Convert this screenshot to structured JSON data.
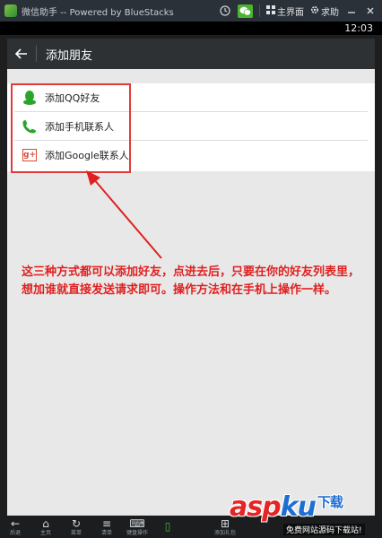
{
  "window": {
    "title": "微信助手 -- Powered by BlueStacks",
    "buttons": {
      "home": "主界面",
      "help": "求助"
    }
  },
  "statusbar": {
    "time": "12:03"
  },
  "actionbar": {
    "title": "添加朋友"
  },
  "list": {
    "items": [
      {
        "label": "添加QQ好友",
        "icon": "qq-penguin-icon"
      },
      {
        "label": "添加手机联系人",
        "icon": "phone-icon"
      },
      {
        "label": "添加Google联系人",
        "icon": "google-plus-icon"
      }
    ]
  },
  "annotation": {
    "text": "这三种方式都可以添加好友，点进去后，只要在你的好友列表里，想加谁就直接发送请求即可。操作方法和在手机上操作一样。"
  },
  "bottombar": {
    "items": [
      {
        "label": "后退",
        "icon": "back-arrow-icon"
      },
      {
        "label": "主页",
        "icon": "home-icon"
      },
      {
        "label": "菜单",
        "icon": "rotate-icon"
      },
      {
        "label": "清单",
        "icon": "menu-icon"
      },
      {
        "label": "键盘操作",
        "icon": "keyboard-icon"
      },
      {
        "label": "",
        "icon": "phone-device-icon"
      },
      {
        "label": "添加礼包",
        "icon": "gift-icon"
      },
      {
        "label": "",
        "icon": "blank"
      }
    ]
  },
  "watermark": {
    "logo_asp": "asp",
    "logo_ku": "ku",
    "logo_cn": "下载",
    "sub": "免费网站源码下载站!"
  },
  "colors": {
    "accent_green": "#4bb52f",
    "annotation_red": "#e02020",
    "actionbar_bg": "#2d3134"
  }
}
